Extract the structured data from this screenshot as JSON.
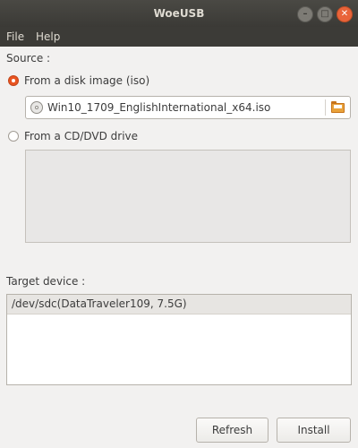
{
  "window": {
    "title": "WoeUSB"
  },
  "menu": {
    "file": "File",
    "help": "Help"
  },
  "source": {
    "label": "Source :",
    "disk_image": {
      "label": "From a disk image (iso)",
      "selected": true
    },
    "file_name": "Win10_1709_EnglishInternational_x64.iso",
    "cd_dvd": {
      "label": "From a CD/DVD drive",
      "selected": false
    }
  },
  "target": {
    "label": "Target device :",
    "devices": [
      "/dev/sdc(DataTraveler109,  7.5G)"
    ]
  },
  "buttons": {
    "refresh": "Refresh",
    "install": "Install"
  },
  "colors": {
    "accent": "#e95420",
    "titlebar": "#3c3b37"
  }
}
